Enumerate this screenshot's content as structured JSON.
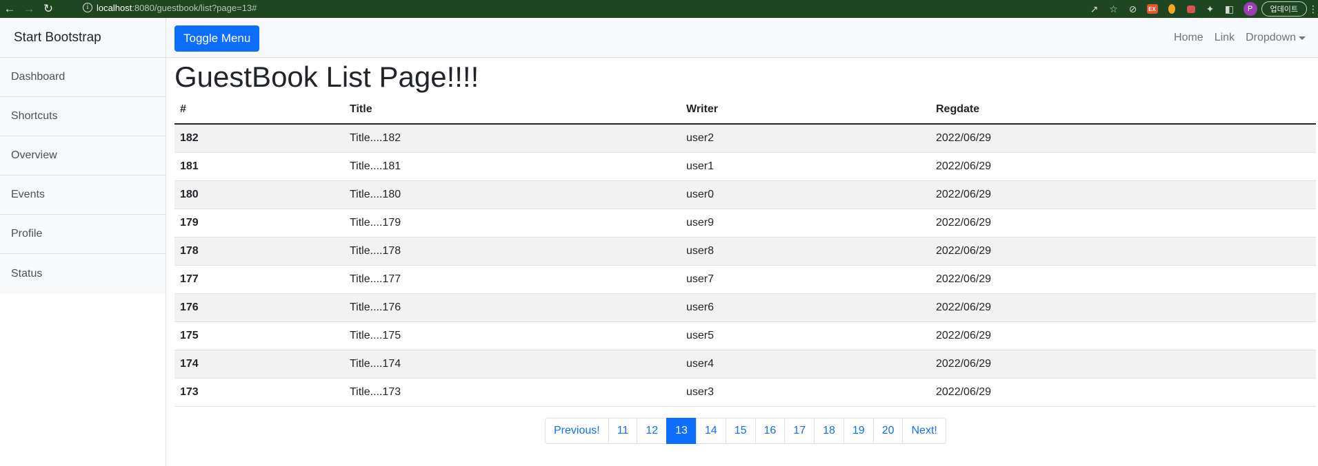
{
  "browser": {
    "url_host": "localhost",
    "url_rest": ":8080/guestbook/list?page=13#",
    "avatar_letter": "P",
    "update_label": "업데이트"
  },
  "sidebar": {
    "heading": "Start Bootstrap",
    "items": [
      {
        "label": "Dashboard"
      },
      {
        "label": "Shortcuts"
      },
      {
        "label": "Overview"
      },
      {
        "label": "Events"
      },
      {
        "label": "Profile"
      },
      {
        "label": "Status"
      }
    ]
  },
  "navbar": {
    "toggle_label": "Toggle Menu",
    "links": [
      {
        "label": "Home"
      },
      {
        "label": "Link"
      },
      {
        "label": "Dropdown"
      }
    ]
  },
  "main": {
    "title": "GuestBook List Page!!!!",
    "table": {
      "headers": [
        "#",
        "Title",
        "Writer",
        "Regdate"
      ],
      "rows": [
        {
          "num": "182",
          "title": "Title....182",
          "writer": "user2",
          "regdate": "2022/06/29"
        },
        {
          "num": "181",
          "title": "Title....181",
          "writer": "user1",
          "regdate": "2022/06/29"
        },
        {
          "num": "180",
          "title": "Title....180",
          "writer": "user0",
          "regdate": "2022/06/29"
        },
        {
          "num": "179",
          "title": "Title....179",
          "writer": "user9",
          "regdate": "2022/06/29"
        },
        {
          "num": "178",
          "title": "Title....178",
          "writer": "user8",
          "regdate": "2022/06/29"
        },
        {
          "num": "177",
          "title": "Title....177",
          "writer": "user7",
          "regdate": "2022/06/29"
        },
        {
          "num": "176",
          "title": "Title....176",
          "writer": "user6",
          "regdate": "2022/06/29"
        },
        {
          "num": "175",
          "title": "Title....175",
          "writer": "user5",
          "regdate": "2022/06/29"
        },
        {
          "num": "174",
          "title": "Title....174",
          "writer": "user4",
          "regdate": "2022/06/29"
        },
        {
          "num": "173",
          "title": "Title....173",
          "writer": "user3",
          "regdate": "2022/06/29"
        }
      ]
    },
    "pagination": {
      "previous_label": "Previous!",
      "pages": [
        "11",
        "12",
        "13",
        "14",
        "15",
        "16",
        "17",
        "18",
        "19",
        "20"
      ],
      "active_page": "13",
      "next_label": "Next!"
    }
  },
  "colors": {
    "primary": "#0d6efd",
    "browser_bar": "#1e4620"
  }
}
